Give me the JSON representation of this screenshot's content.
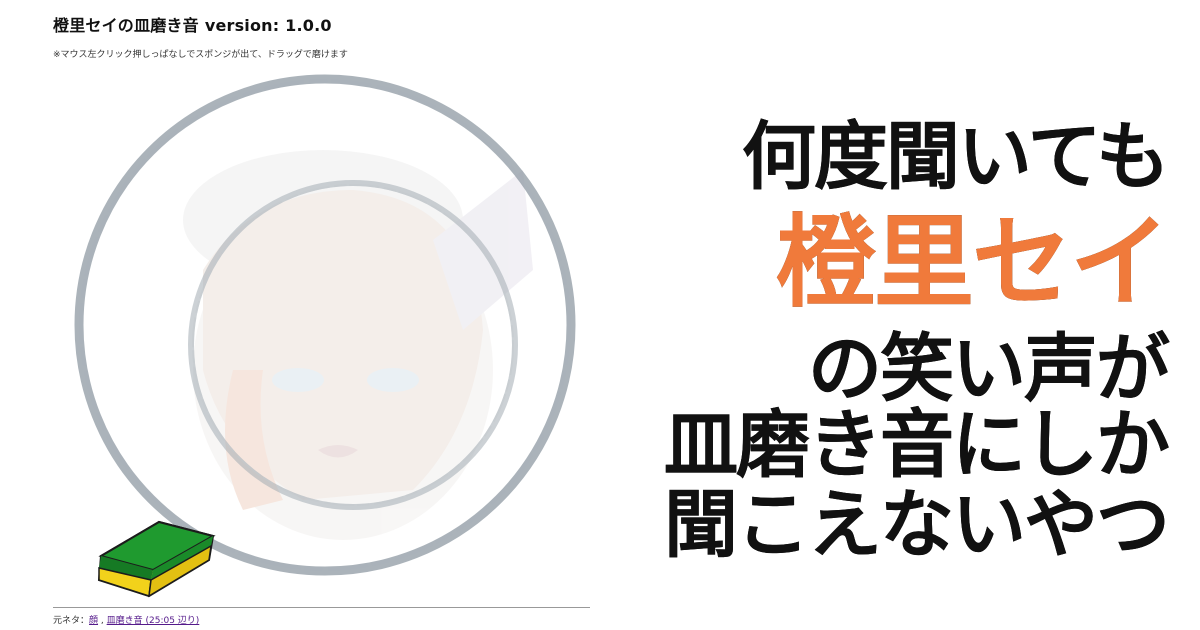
{
  "header": {
    "title": "橙里セイの皿磨き音",
    "version": "version: 1.0.0",
    "instruction": "※マウス左クリック押しっぱなしでスポンジが出て、ドラッグで磨けます"
  },
  "footer": {
    "prefix": "元ネタ：",
    "link1": "顔",
    "separator": " , ",
    "link2": "皿磨き音 (25:05 辺り)"
  },
  "headline": {
    "line1": "何度聞いても",
    "line2": "橙里セイ",
    "line3": "の笑い声が",
    "line4": "皿磨き音にしか",
    "line5": "聞こえないやつ"
  },
  "colors": {
    "accent": "#f07a3b",
    "plate_rim": "#8f9aa3",
    "sponge_green": "#1a8f2e",
    "sponge_yellow": "#f2d21b"
  },
  "icons": {
    "plate": "plate-icon",
    "sponge": "sponge-icon"
  }
}
